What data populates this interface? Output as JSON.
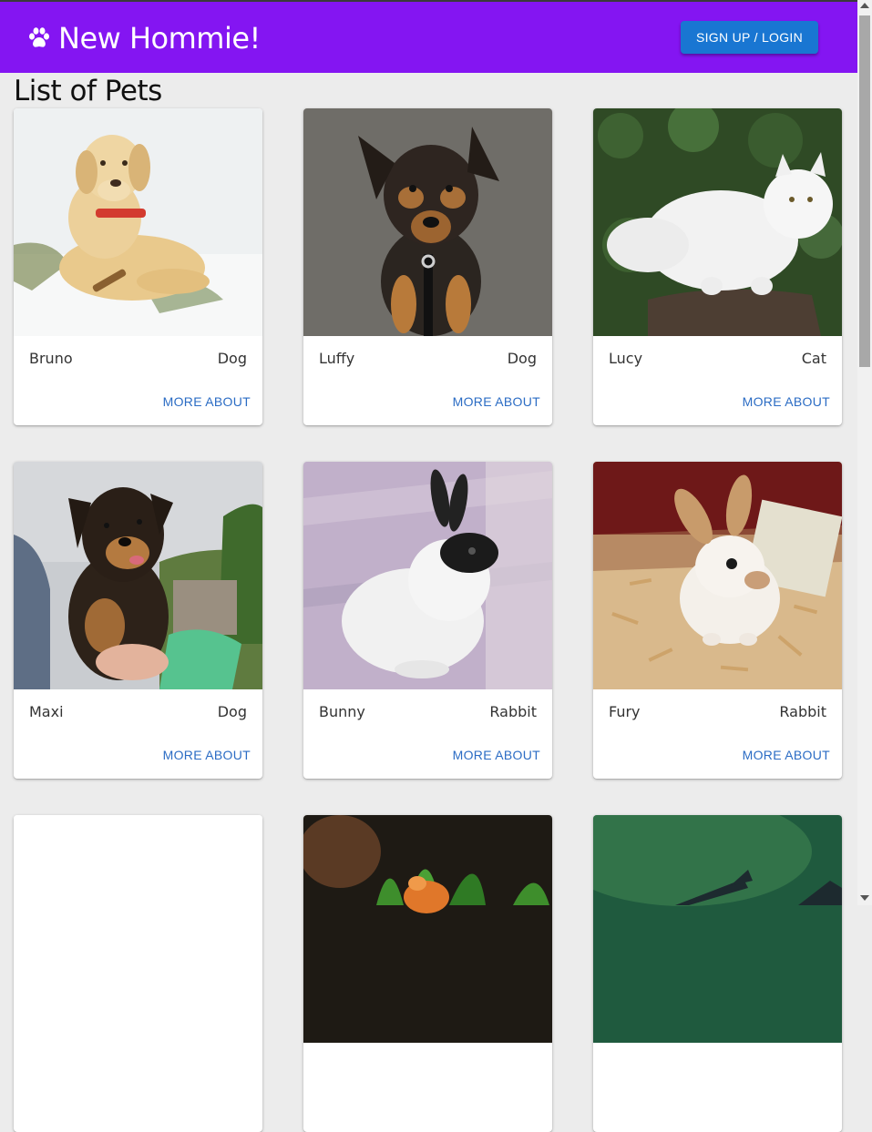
{
  "appbar": {
    "title": "New Hommie!",
    "icon": "paw-icon",
    "login_label": "SIGN UP / LOGIN",
    "color": "#8415f2"
  },
  "page": {
    "title": "List of Pets"
  },
  "pets": [
    {
      "name": "Bruno",
      "type": "Dog",
      "action": "MORE ABOUT"
    },
    {
      "name": "Luffy",
      "type": "Dog",
      "action": "MORE ABOUT"
    },
    {
      "name": "Lucy",
      "type": "Cat",
      "action": "MORE ABOUT"
    },
    {
      "name": "Maxi",
      "type": "Dog",
      "action": "MORE ABOUT"
    },
    {
      "name": "Bunny",
      "type": "Rabbit",
      "action": "MORE ABOUT"
    },
    {
      "name": "Fury",
      "type": "Rabbit",
      "action": "MORE ABOUT"
    }
  ]
}
